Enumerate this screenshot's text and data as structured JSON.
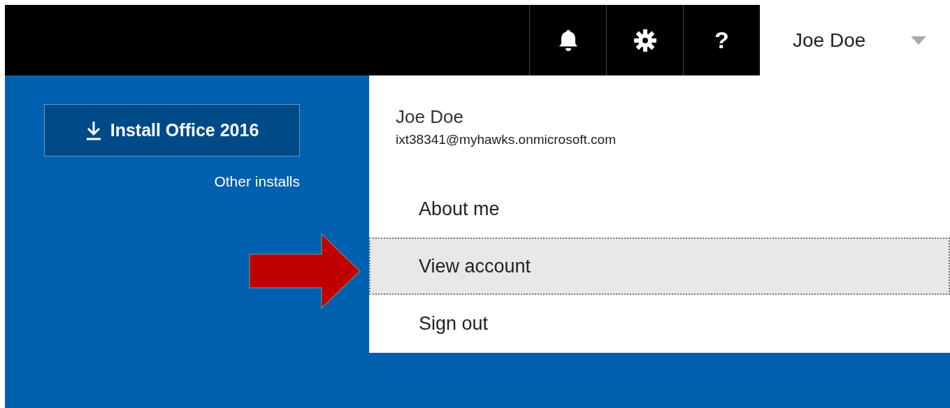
{
  "top_bar": {
    "icons": [
      {
        "kind": "bell"
      },
      {
        "kind": "gear"
      },
      {
        "kind": "help",
        "label": "?"
      }
    ],
    "user_button": {
      "label": "Joe Doe"
    }
  },
  "install_button": {
    "label": "Install Office 2016"
  },
  "other_installs_link": "Other installs",
  "account_menu": {
    "name": "Joe Doe",
    "email": "ixt38341@myhawks.onmicrosoft.com",
    "items": [
      {
        "label": "About me",
        "selected": false
      },
      {
        "label": "View account",
        "selected": true
      },
      {
        "label": "Sign out",
        "selected": false
      }
    ]
  },
  "annotation": {
    "kind": "arrow",
    "color": "#c00000"
  }
}
